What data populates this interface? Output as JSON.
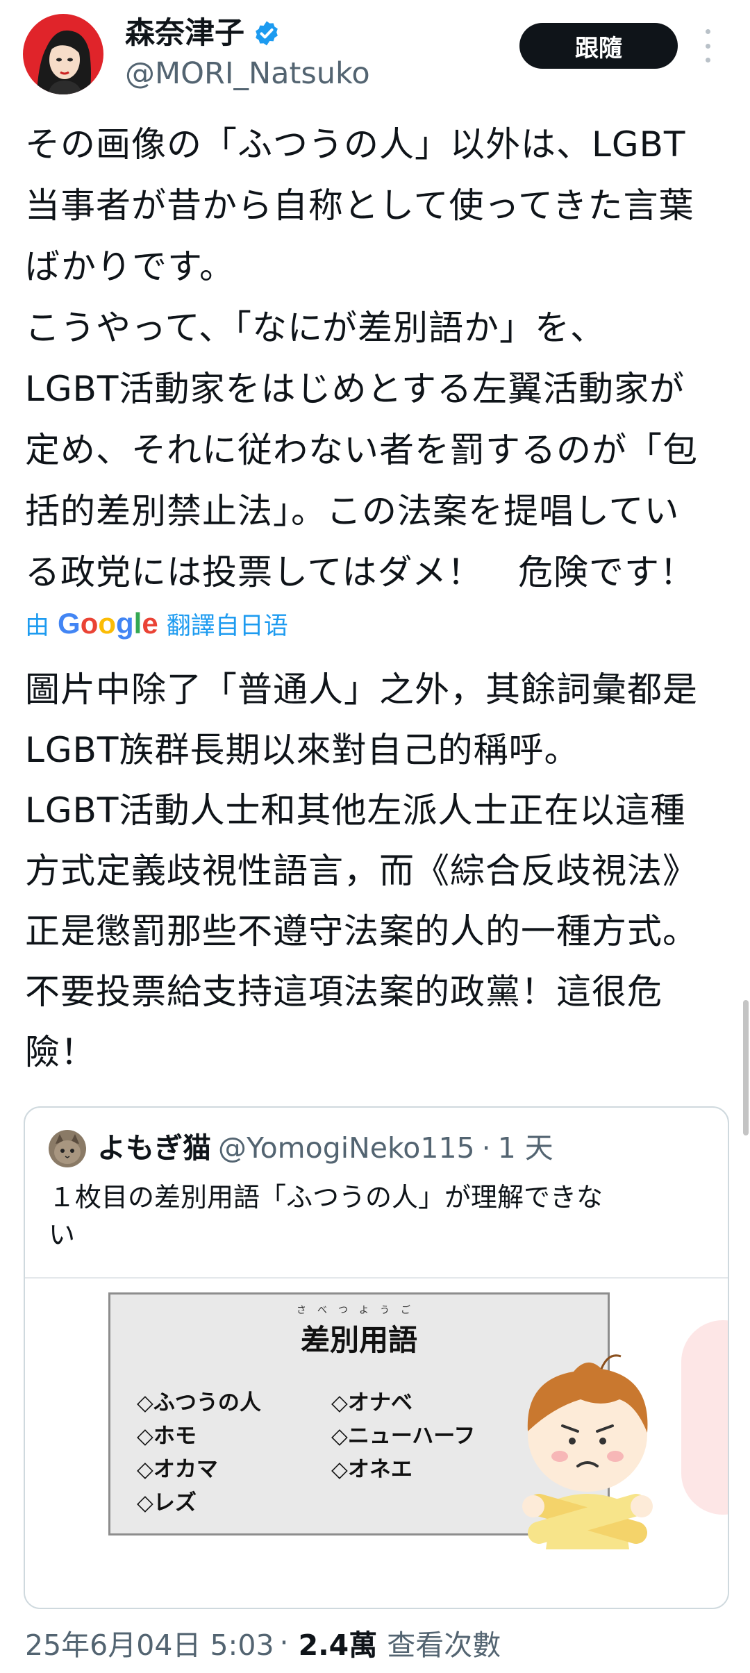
{
  "author": {
    "display_name": "森奈津子",
    "handle": "@MORI_Natsuko",
    "verified_icon": "verified-badge-icon",
    "accent_color": "#1d9bf0"
  },
  "follow_button": {
    "label": "跟隨"
  },
  "more_icon": "more-vertical-icon",
  "tweet": {
    "text": "その画像の「ふつうの人」以外は、LGBT\n当事者が昔から自称として使ってきた言葉\nばかりです。\nこうやって、「なにが差別語か」を、\nLGBT活動家をはじめとする左翼活動家が\n定め、それに従わない者を罰するのが「包\n括的差別禁止法」。この法案を提唱してい\nる政党には投票してはダメ！　危険です！"
  },
  "translation": {
    "prefix": "由",
    "logo": "Google",
    "suffix": "翻譯自日语",
    "text": "圖片中除了「普通人」之外，其餘詞彙都是\nLGBT族群長期以來對自己的稱呼。\nLGBT活動人士和其他左派人士正在以這種\n方式定義歧視性語言，而《綜合反歧視法》\n正是懲罰那些不遵守法案的人的一種方式。\n不要投票給支持這項法案的政黨！這很危\n險！"
  },
  "quoted": {
    "display_name": "よもぎ猫",
    "handle": "@YomogiNeko115",
    "separator": "·",
    "time": "1 天",
    "text": "１枚目の差別用語「ふつうの人」が理解できな\nい",
    "image": {
      "ruby": "さべつようご",
      "title": "差別用語",
      "terms_left": [
        "◇ふつうの人",
        "◇ホモ",
        "◇オカマ",
        "◇レズ"
      ],
      "terms_right": [
        "◇オナベ",
        "◇ニューハーフ",
        "◇オネエ"
      ]
    }
  },
  "meta": {
    "date": "25年6月04日 5:03",
    "separator": "·",
    "views": "2.4萬",
    "views_label": "查看次數"
  }
}
